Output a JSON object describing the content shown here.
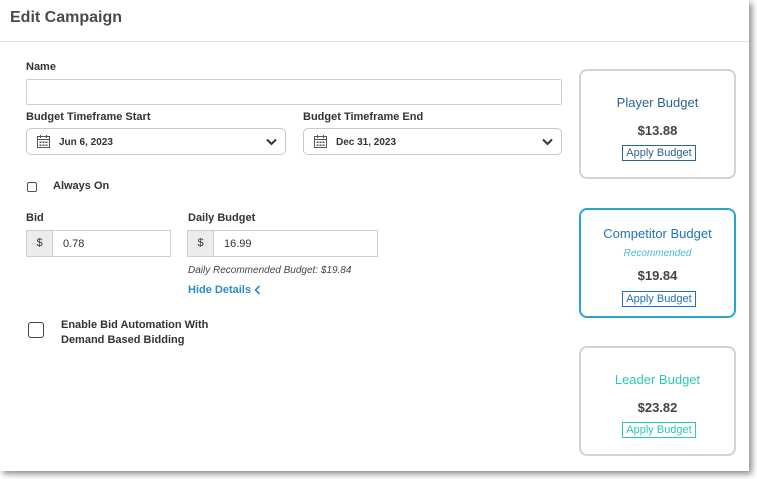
{
  "header": {
    "title": "Edit Campaign"
  },
  "form": {
    "name_label": "Name",
    "name_value": "",
    "start_label": "Budget Timeframe Start",
    "start_value": "Jun 6, 2023",
    "end_label": "Budget Timeframe End",
    "end_value": "Dec 31, 2023",
    "always_on_label": "Always On",
    "always_on_checked": false,
    "bid_label": "Bid",
    "bid_currency": "$",
    "bid_value": "0.78",
    "daily_budget_label": "Daily Budget",
    "daily_budget_currency": "$",
    "daily_budget_value": "16.99",
    "daily_recommended_text": "Daily Recommended Budget: $19.84",
    "hide_details_label": "Hide Details",
    "bid_automation_label_line1": "Enable Bid Automation With",
    "bid_automation_label_line2": "Demand Based Bidding",
    "bid_automation_checked": false
  },
  "budget_cards": [
    {
      "name": "Player Budget",
      "recommended": "",
      "amount": "$13.88",
      "apply_label": "Apply Budget",
      "color": "#2a6496",
      "selected": false
    },
    {
      "name": "Competitor Budget",
      "recommended": "Recommended",
      "amount": "$19.84",
      "apply_label": "Apply Budget",
      "color": "#1e73b8",
      "selected": true
    },
    {
      "name": "Leader Budget",
      "recommended": "",
      "amount": "$23.82",
      "apply_label": "Apply Budget",
      "color": "#2ec7b0",
      "selected": false
    }
  ],
  "colors": {
    "link": "#2a8fc2",
    "selected_border": "#2aa3d1",
    "card_border": "#d3d3d3"
  },
  "icons": [
    "calendar-icon",
    "chevron-down-icon",
    "chevron-left-icon"
  ]
}
